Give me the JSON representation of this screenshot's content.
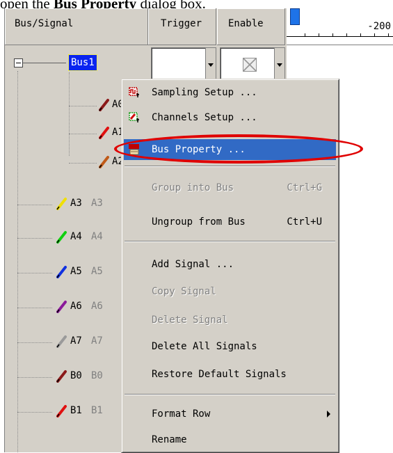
{
  "caption": {
    "prefix": "open the ",
    "bold": "Bus Property",
    "suffix": " dialog box."
  },
  "header": {
    "bus_signal": "Bus/Signal",
    "trigger": "Trigger",
    "enable": "Enable",
    "time_value": "-200"
  },
  "tree": {
    "bus": "Bus1",
    "signals": [
      {
        "name": "A0",
        "alias": "",
        "color": "#8b1a1a"
      },
      {
        "name": "A1",
        "alias": "",
        "color": "#e01010"
      },
      {
        "name": "A2",
        "alias": "",
        "color": "#c05a18"
      },
      {
        "name": "A3",
        "alias": "A3",
        "color": "#f0e000"
      },
      {
        "name": "A4",
        "alias": "A4",
        "color": "#10d010"
      },
      {
        "name": "A5",
        "alias": "A5",
        "color": "#1030e0"
      },
      {
        "name": "A6",
        "alias": "A6",
        "color": "#8a1a9a"
      },
      {
        "name": "A7",
        "alias": "A7",
        "color": "#9a9a9a"
      },
      {
        "name": "B0",
        "alias": "B0",
        "color": "#8b1a1a"
      },
      {
        "name": "B1",
        "alias": "B1",
        "color": "#e01010"
      }
    ]
  },
  "menu": {
    "sampling_setup": "Sampling Setup ...",
    "channels_setup": "Channels Setup ...",
    "bus_property": "Bus Property ...",
    "group_into_bus": "Group into Bus",
    "group_shortcut": "Ctrl+G",
    "ungroup_from_bus": "Ungroup from Bus",
    "ungroup_shortcut": "Ctrl+U",
    "add_signal": "Add Signal ...",
    "copy_signal": "Copy Signal",
    "delete_signal": "Delete Signal",
    "delete_all_signals": "Delete All Signals",
    "restore_default_signals": "Restore Default Signals",
    "format_row": "Format Row",
    "rename": "Rename"
  },
  "colors": {
    "selection": "#316ac5",
    "bus_highlight": "#0a24f0",
    "annotation": "#e00000"
  }
}
